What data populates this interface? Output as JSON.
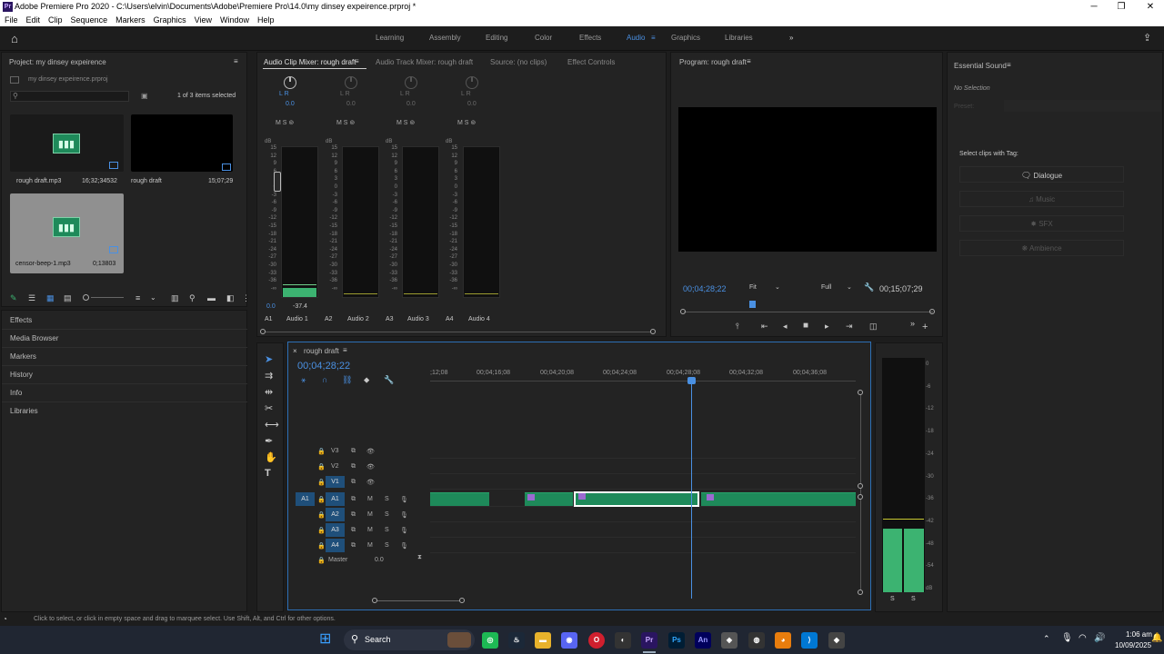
{
  "window": {
    "title": "Adobe Premiere Pro 2020 - C:\\Users\\elvin\\Documents\\Adobe\\Premiere Pro\\14.0\\my dinsey expeirence.prproj *",
    "app_icon": "Pr"
  },
  "menu": [
    "File",
    "Edit",
    "Clip",
    "Sequence",
    "Markers",
    "Graphics",
    "View",
    "Window",
    "Help"
  ],
  "workspaces": [
    {
      "label": "Learning"
    },
    {
      "label": "Assembly"
    },
    {
      "label": "Editing"
    },
    {
      "label": "Color"
    },
    {
      "label": "Effects"
    },
    {
      "label": "Audio",
      "active": true
    },
    {
      "label": "Graphics"
    },
    {
      "label": "Libraries"
    }
  ],
  "project": {
    "title": "Project: my dinsey expeirence",
    "file": "my dinsey expeirence.prproj",
    "selected_count": "1 of 3 items selected",
    "items": [
      {
        "name": "rough draft.mp3",
        "duration": "16;32;34532"
      },
      {
        "name": "rough draft",
        "duration": "15;07;29"
      },
      {
        "name": "censor-beep-1.mp3",
        "duration": "0;13803"
      }
    ]
  },
  "side_panels": [
    "Effects",
    "Media Browser",
    "Markers",
    "History",
    "Info",
    "Libraries"
  ],
  "mixer_tabs": [
    "Audio Clip Mixer: rough draft",
    "Audio Track Mixer: rough draft",
    "Source: (no clips)",
    "Effect Controls"
  ],
  "mixer": {
    "lr": "L   R",
    "pan_value": "0.0",
    "ch_buttons": "M  S  ⊚",
    "db_label": "dB",
    "scale": [
      "15",
      "12",
      "9",
      "6",
      "3",
      "0",
      "-3",
      "-6",
      "-9",
      "-12",
      "-15",
      "-18",
      "-21",
      "-24",
      "-27",
      "-30",
      "-33",
      "-36",
      "-∞"
    ],
    "channels": [
      {
        "id": "A1",
        "name": "Audio 1",
        "level": "0.0",
        "peak": "-37.4"
      },
      {
        "id": "A2",
        "name": "Audio 2"
      },
      {
        "id": "A3",
        "name": "Audio 3"
      },
      {
        "id": "A4",
        "name": "Audio 4"
      }
    ]
  },
  "program": {
    "title": "Program: rough draft",
    "timecode": "00;04;28;22",
    "fit": "Fit",
    "quality": "Full",
    "duration": "00;15;07;29"
  },
  "essential_sound": {
    "title": "Essential Sound",
    "selection": "No Selection",
    "preset": "Preset:",
    "tag_label": "Select clips with Tag:",
    "tags": [
      "Dialogue",
      "Music",
      "SFX",
      "Ambience"
    ]
  },
  "timeline": {
    "title": "rough draft",
    "timecode": "00;04;28;22",
    "ruler": [
      ";12;08",
      "00;04;16;08",
      "00;04;20;08",
      "00;04;24;08",
      "00;04;28;08",
      "00;04;32;08",
      "00;04;36;08"
    ],
    "video_tracks": [
      "V3",
      "V2",
      "V1"
    ],
    "audio_tracks": [
      "A1",
      "A2",
      "A3",
      "A4"
    ],
    "source_patch": "A1",
    "master": {
      "label": "Master",
      "value": "0.0"
    },
    "m": "M",
    "s": "S"
  },
  "master_meter": {
    "scale": [
      "0",
      "-6",
      "-12",
      "-18",
      "-24",
      "-30",
      "-36",
      "-42",
      "-48",
      "-54",
      "dB"
    ],
    "solo": [
      "S",
      "S"
    ]
  },
  "status": "Click to select, or click in empty space and drag to marquee select. Use Shift, Alt, and Ctrl for other options.",
  "taskbar": {
    "search": "Search",
    "time": "1:06 am",
    "date": "10/09/2025",
    "apps": [
      "Ps",
      "An"
    ],
    "premiere": "Pr"
  }
}
